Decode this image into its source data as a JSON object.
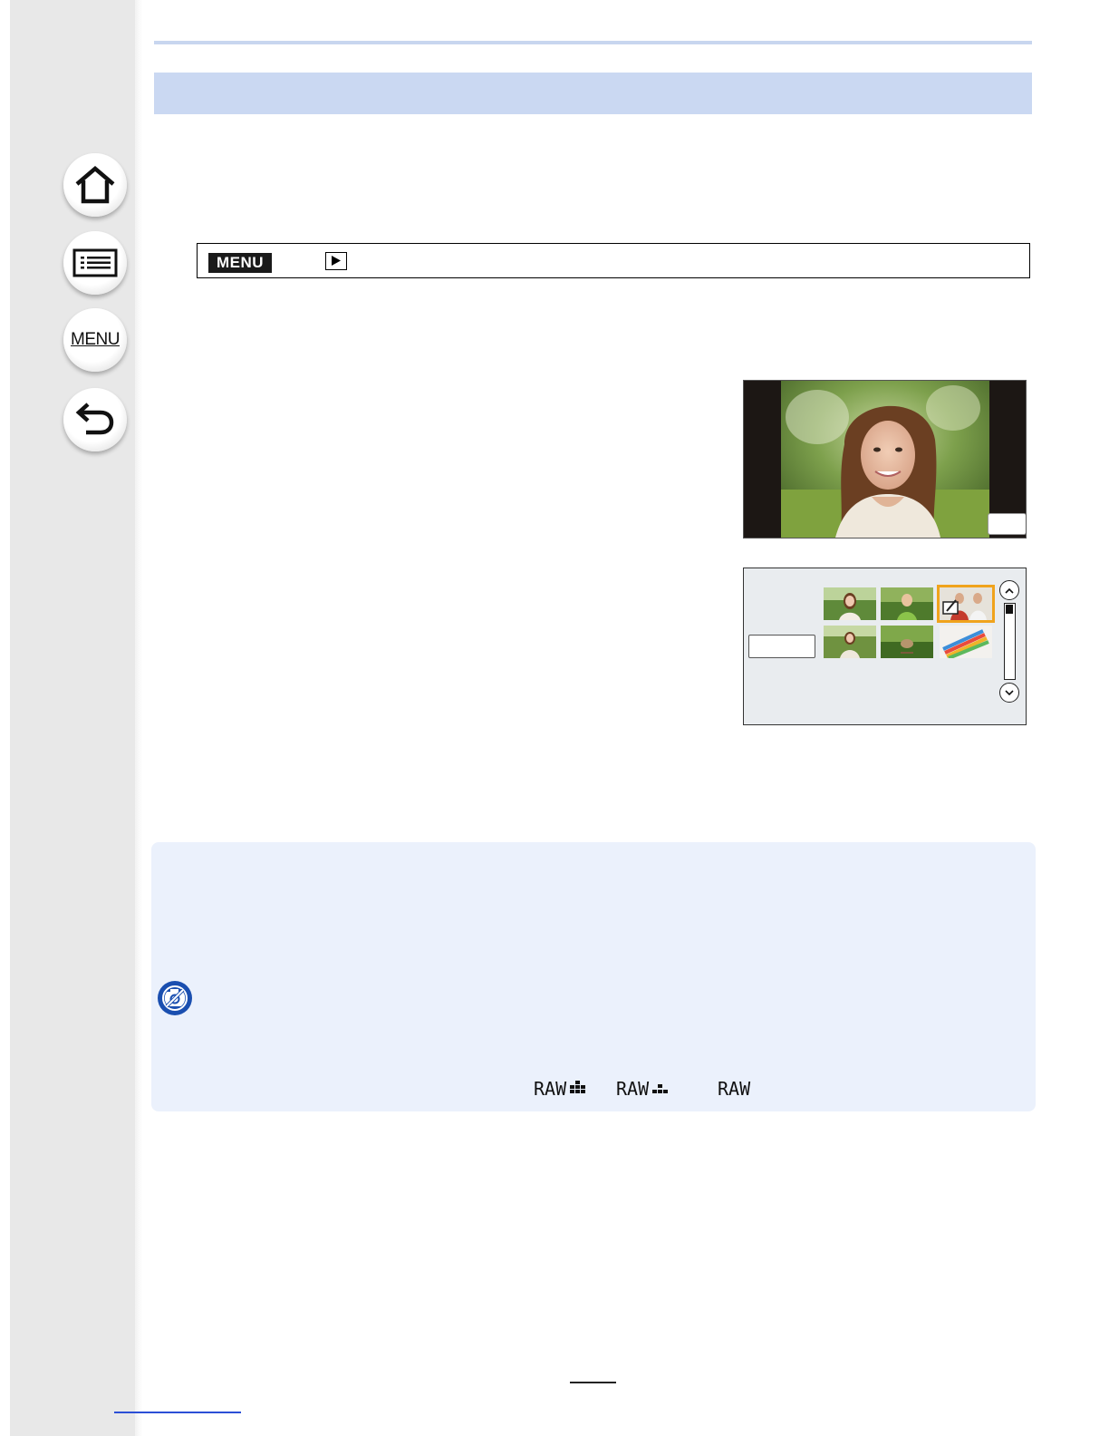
{
  "sidebar": {
    "items": [
      {
        "name": "home",
        "icon": "home-icon"
      },
      {
        "name": "contents",
        "icon": "list-icon"
      },
      {
        "name": "menu",
        "icon": "menu-icon",
        "label": "MENU"
      },
      {
        "name": "back",
        "icon": "back-arrow-icon"
      }
    ]
  },
  "menu_path": {
    "badge_label": "MENU",
    "playback_icon": "playback-icon"
  },
  "raw_modes": [
    {
      "label": "RAW",
      "icon": "raw-fine-icon"
    },
    {
      "label": "RAW",
      "icon": "raw-standard-icon"
    },
    {
      "label": "RAW",
      "icon": "raw-only-icon"
    }
  ],
  "colors": {
    "title_band": "#cad8f2",
    "note_panel": "#ebf1fc",
    "selection": "#f0a31c",
    "note_icon": "#1a4fb0"
  }
}
